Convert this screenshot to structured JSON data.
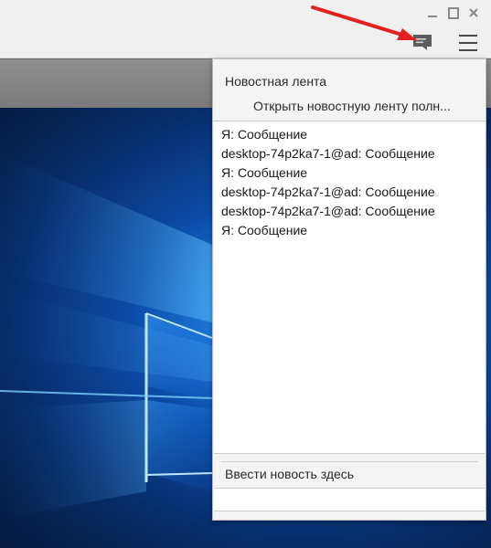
{
  "window_controls": {
    "minimize_icon": "minimize-icon",
    "maximize_icon": "maximize-icon",
    "close_icon": "close-icon"
  },
  "toolbar": {
    "feed_icon": "chat-bubble-icon",
    "menu_icon": "hamburger-menu-icon",
    "accent_arrow_color": "#e32020"
  },
  "popup": {
    "title": "Новостная лента",
    "open_full_link": "Открыть новостную ленту полн...",
    "messages": [
      "Я: Сообщение",
      "desktop-74p2ka7-1@ad: Сообщение",
      "Я: Сообщение",
      "desktop-74p2ka7-1@ad: Сообщение",
      "desktop-74p2ka7-1@ad: Сообщение",
      "Я: Сообщение"
    ],
    "input_label": "Ввести новость здесь",
    "input_value": ""
  }
}
